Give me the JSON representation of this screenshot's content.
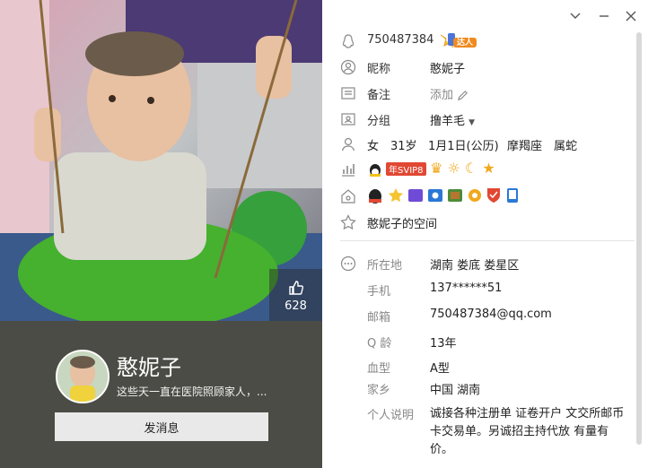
{
  "profile": {
    "qq_number": "750487384",
    "badge_label": "达人",
    "nickname_label": "昵称",
    "nickname": "憨妮子",
    "remark_label": "备注",
    "remark_placeholder": "添加",
    "group_label": "分组",
    "group_value": "撸羊毛",
    "gender": "女",
    "age": "31岁",
    "birthday": "1月1日(公历)",
    "constellation": "摩羯座",
    "zodiac": "属蛇",
    "vip_label": "年SVIP8",
    "space_link": "憨妮子的空间"
  },
  "details": {
    "location_label": "所在地",
    "location_value": "湖南 娄底 娄星区",
    "phone_label": "手机",
    "phone_value": "137******51",
    "email_label": "邮箱",
    "email_value": "750487384@qq.com",
    "qage_label": "Q 龄",
    "qage_value": "13年",
    "blood_label": "血型",
    "blood_value": "A型",
    "hometown_label": "家乡",
    "hometown_value": "中国 湖南",
    "intro_label": "个人说明",
    "intro_value": "诚接各种注册单  证卷开户   文交所邮币卡交易单。另诚招主持代放   有量有价。"
  },
  "left": {
    "likes": "628",
    "nickname": "憨妮子",
    "signature": "这些天一直在医院照顾家人，...",
    "send_button": "发消息"
  },
  "colors": {
    "left_bottom": "#4b4c45",
    "vip_red": "#e14833",
    "accent_blue": "#2a77d6"
  }
}
